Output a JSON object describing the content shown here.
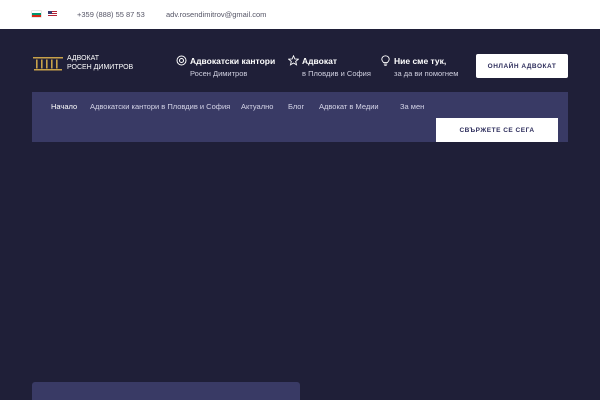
{
  "topbar": {
    "languages": [
      {
        "code": "bg",
        "icon": "bulgaria-flag-icon"
      },
      {
        "code": "en",
        "icon": "usa-flag-icon"
      }
    ],
    "phone": "+359 (888) 55 87 53",
    "email": "adv.rosendimitrov@gmail.com"
  },
  "logo": {
    "line1": "АДВОКАТ",
    "line2": "РОСЕН ДИМИТРОВ",
    "color": "#c8a24a"
  },
  "info": [
    {
      "icon": "target-icon",
      "title": "Адвокатски кантори",
      "subtitle": "Росен Димитров"
    },
    {
      "icon": "star-icon",
      "title": "Адвокат",
      "subtitle": "в Пловдив и София"
    },
    {
      "icon": "lightbulb-icon",
      "title": "Ние сме тук,",
      "subtitle": "за да ви помогнем"
    }
  ],
  "buttons": {
    "online_lawyer": "ОНЛАЙН АДВОКАТ",
    "contact_us": "СВЪРЖЕТЕ СЕ СЕГА"
  },
  "nav": {
    "items": [
      {
        "label": "Начало",
        "active": true
      },
      {
        "label": "Адвокатски кантори в Пловдив и София",
        "active": false
      },
      {
        "label": "Актуално",
        "active": false
      },
      {
        "label": "Блог",
        "active": false
      },
      {
        "label": "Адвокат в Медии",
        "active": false
      },
      {
        "label": "За мен",
        "active": false
      }
    ]
  },
  "colors": {
    "background": "#1f1f38",
    "nav_background": "#393a65",
    "accent_gold": "#c8a24a"
  }
}
